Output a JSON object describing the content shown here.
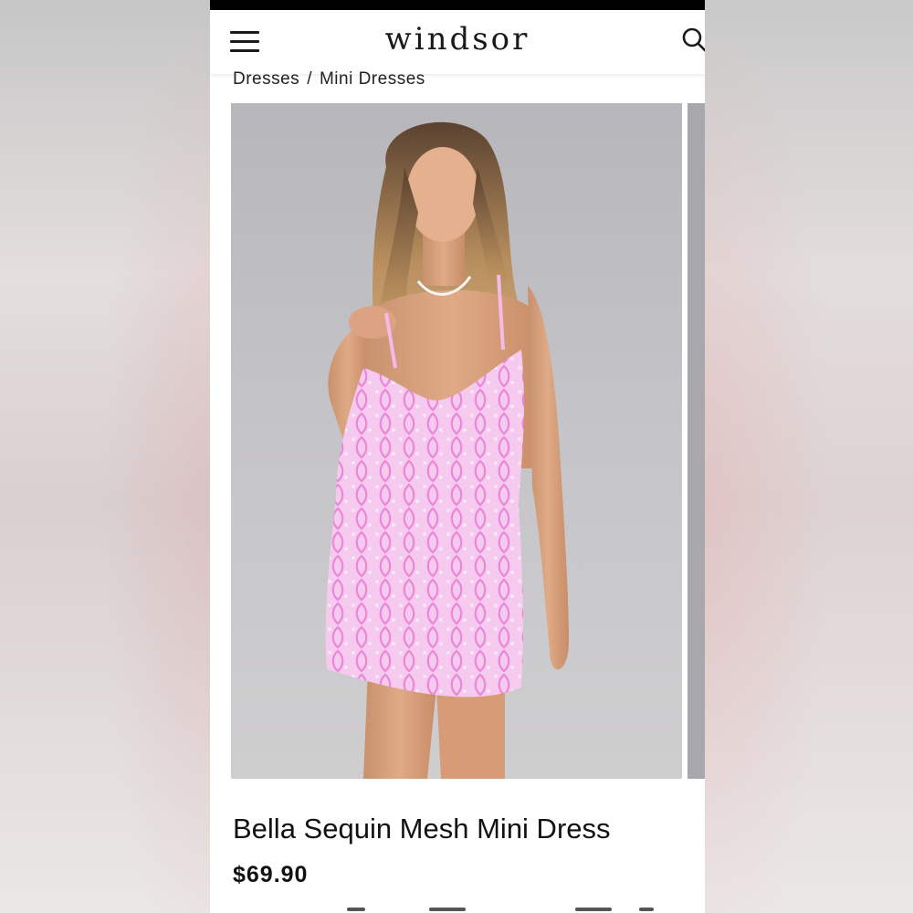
{
  "header": {
    "logo": "windsor",
    "menu_icon": "hamburger-menu-icon",
    "search_icon": "search-icon"
  },
  "breadcrumb": {
    "items": [
      "Dresses",
      "Mini Dresses"
    ],
    "separator": "/"
  },
  "product": {
    "title": "Bella Sequin Mesh Mini Dress",
    "price": "$69.90",
    "image": "product-photo-pink-sequin-mini-dress"
  },
  "colors": {
    "brand_text": "#1a1a1a",
    "dress_pink": "#f2b6e6",
    "photo_bg": "#c4c3c7"
  }
}
